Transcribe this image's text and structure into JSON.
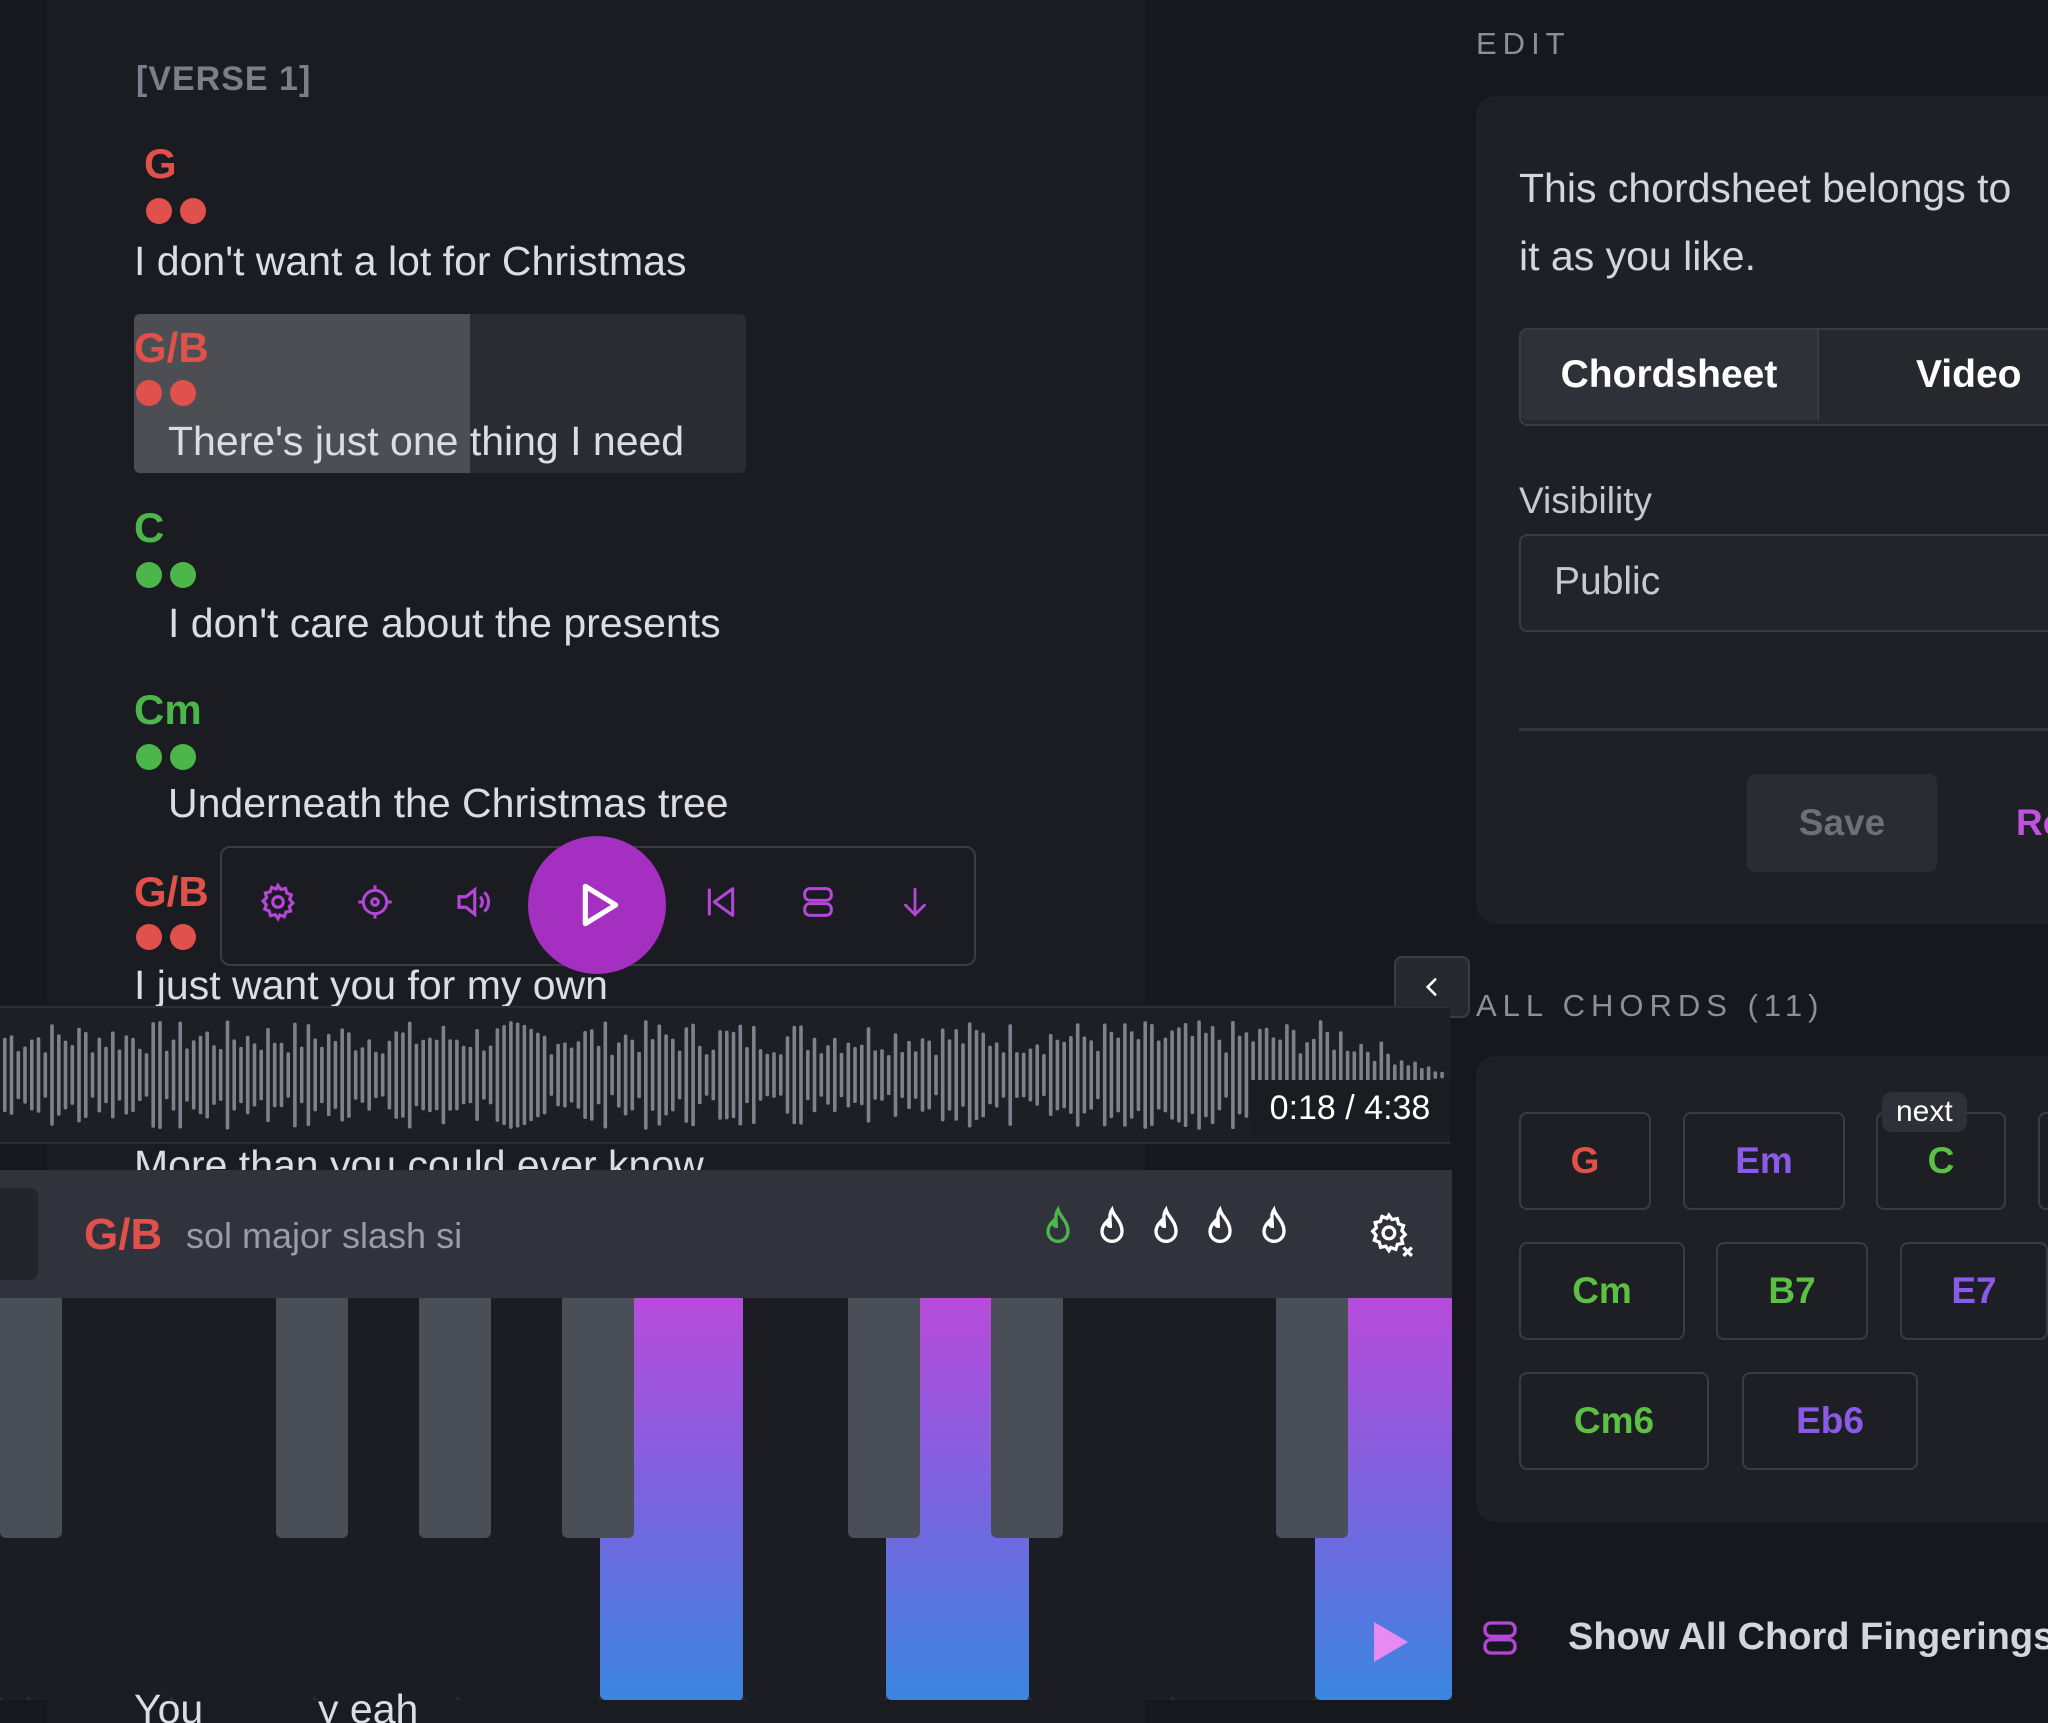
{
  "section_label": "[VERSE 1]",
  "lines": [
    {
      "chord": "G",
      "chord_color": "#e0514b",
      "lyric": "I don't want a lot for Christmas"
    },
    {
      "chord": "G/B",
      "chord_color": "#e0514b",
      "lyric": "There's just one thing I need"
    },
    {
      "chord": "C",
      "chord_color": "#4cb64a",
      "lyric": "I don't care about the presents"
    },
    {
      "chord": "Cm",
      "chord_color": "#4cb64a",
      "lyric": "Underneath the Christmas tree"
    },
    {
      "chord": "G/B",
      "chord_color": "#e0514b",
      "lyric": "I just want you for my own"
    }
  ],
  "partial_lyric": "More than you could ever know",
  "bottom_lyric_parts": [
    "You",
    "y  eah"
  ],
  "player": {
    "icons": [
      "gear-icon",
      "target-icon",
      "speaker-icon",
      "play-icon",
      "skip-back-icon",
      "layout-icon",
      "arrow-down-icon"
    ],
    "accent_color": "#a42fc1"
  },
  "audio": {
    "time": "0:18 / 4:38",
    "position_fraction": 0.065
  },
  "piano": {
    "chord": "G/B",
    "chord_name": "sol major slash si",
    "difficulty_level": 1,
    "difficulty_max": 5
  },
  "edit": {
    "label": "EDIT",
    "description": "This chordsheet belongs to",
    "description_line2": "it as you like.",
    "tabs": [
      "Chordsheet",
      "Video"
    ],
    "visibility_label": "Visibility",
    "visibility_value": "Public",
    "save_label": "Save",
    "reset_label": "Re"
  },
  "all_chords": {
    "label": "ALL CHORDS (11)",
    "next_tag": "next",
    "chords": [
      {
        "name": "G",
        "color": "red"
      },
      {
        "name": "Em",
        "color": "purple"
      },
      {
        "name": "C",
        "color": "green"
      },
      {
        "name": "Cm",
        "color": "green"
      },
      {
        "name": "B7",
        "color": "green"
      },
      {
        "name": "E7",
        "color": "purple"
      },
      {
        "name": "Cm6",
        "color": "green"
      },
      {
        "name": "Eb6",
        "color": "purple"
      }
    ],
    "show_all_label": "Show All Chord Fingerings"
  }
}
